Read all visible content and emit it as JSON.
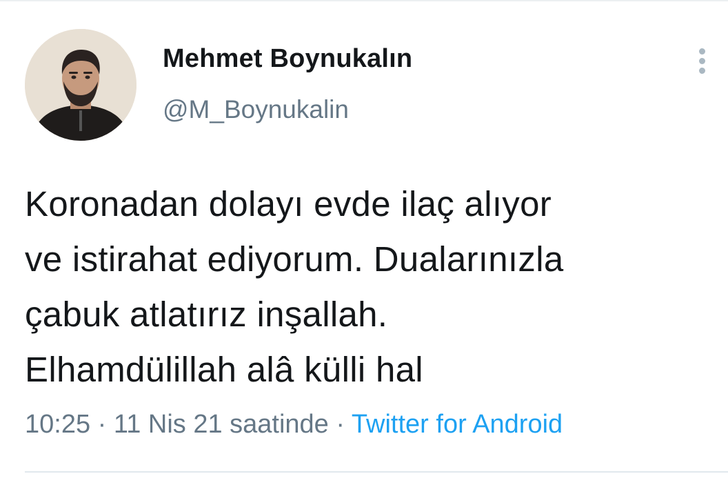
{
  "author": {
    "display_name": "Mehmet Boynukalın",
    "handle": "@M_Boynukalin",
    "avatar_icon": "profile-photo"
  },
  "more_options_icon": "vertical-dots-icon",
  "tweet": {
    "lines": [
      "Koronadan dolayı evde ilaç alıyor",
      "ve istirahat ediyorum. Dualarınızla",
      "çabuk atlatırız inşallah.",
      "Elhamdülillah alâ külli hal"
    ],
    "time": "10:25",
    "separator": " · ",
    "date": "11 Nis 21 saatinde",
    "source": "Twitter for Android"
  },
  "colors": {
    "text": "#14171a",
    "secondary": "#657786",
    "link": "#1da1f2",
    "divider": "#e1e8ed"
  }
}
